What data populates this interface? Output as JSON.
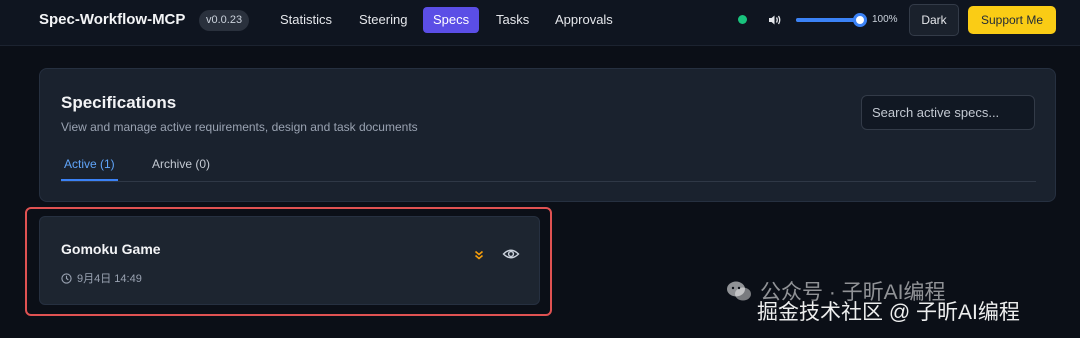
{
  "header": {
    "app_name": "Spec-Workflow-MCP",
    "version": "v0.0.23",
    "nav": [
      {
        "label": "Statistics",
        "active": false
      },
      {
        "label": "Steering",
        "active": false
      },
      {
        "label": "Specs",
        "active": true
      },
      {
        "label": "Tasks",
        "active": false
      },
      {
        "label": "Approvals",
        "active": false
      }
    ],
    "volume_percent": "100%",
    "volume_level": 1.0,
    "theme_button": "Dark",
    "support_button": "Support Me"
  },
  "specs_panel": {
    "title": "Specifications",
    "subtitle": "View and manage active requirements, design and task documents",
    "search_placeholder": "Search active specs...",
    "tabs": [
      {
        "label": "Active (1)",
        "active": true
      },
      {
        "label": "Archive (0)",
        "active": false
      }
    ]
  },
  "spec_cards": [
    {
      "title": "Gomoku Game",
      "timestamp": "9月4日 14:49"
    }
  ],
  "watermark": {
    "line1": "公众号 · 子昕AI编程",
    "line2": "掘金技术社区 @ 子昕AI编程"
  },
  "colors": {
    "accent": "#5b4ee6",
    "support": "#facc15",
    "status": "#19c37d",
    "tab_active": "#60a5fa",
    "highlight": "#e05252"
  },
  "icons": {
    "status": "status-dot",
    "audio": "speaker-icon",
    "clock": "clock-icon",
    "expand": "double-chevron-down-icon",
    "view": "eye-icon",
    "wechat": "wechat-icon"
  }
}
